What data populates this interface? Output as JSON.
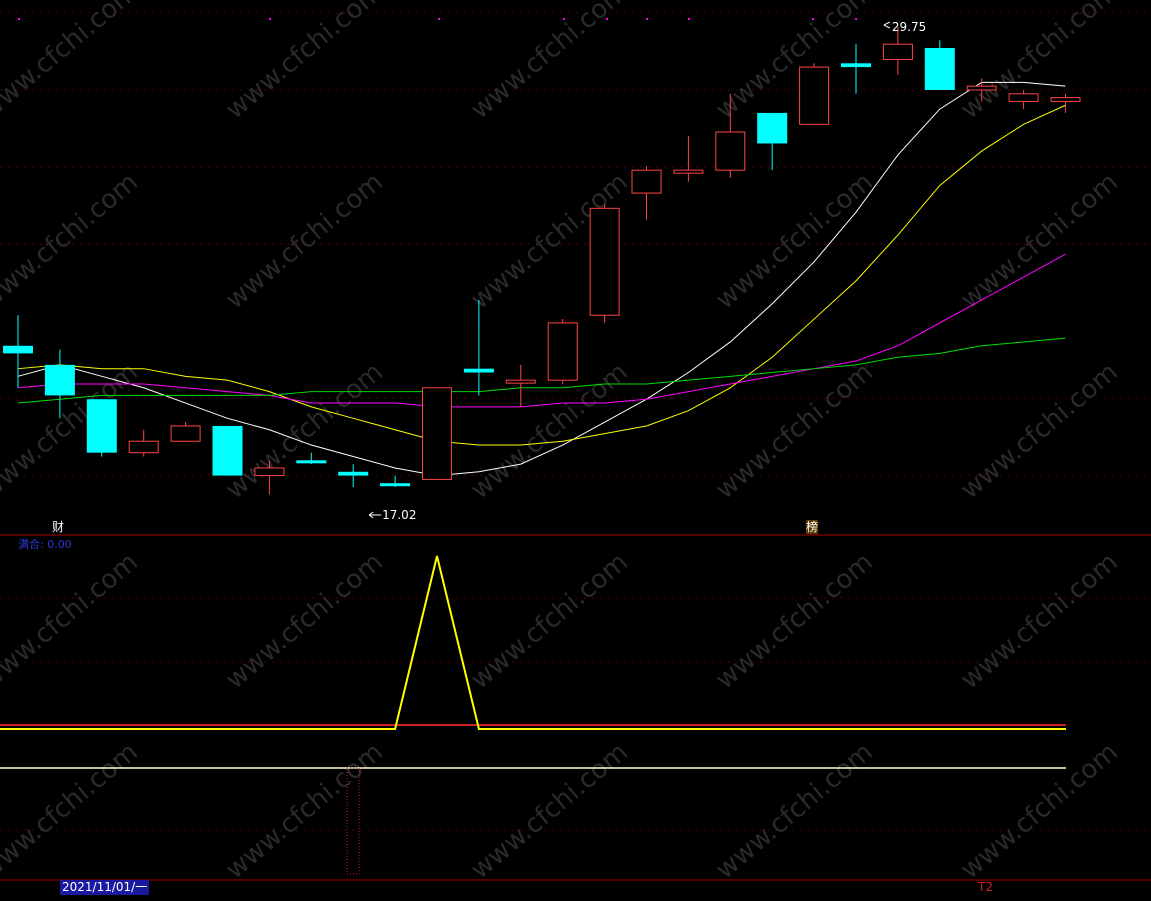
{
  "chart_data": {
    "type": "candlestick",
    "price_labels": {
      "high": "29.75",
      "low": "17.02"
    },
    "candles": [
      {
        "o": 21.4,
        "h": 22.2,
        "l": 20.3,
        "c": 21.2,
        "dir": "down"
      },
      {
        "o": 20.9,
        "h": 21.3,
        "l": 19.5,
        "c": 20.1,
        "dir": "down"
      },
      {
        "o": 20.0,
        "h": 20.0,
        "l": 18.5,
        "c": 18.6,
        "dir": "down"
      },
      {
        "o": 18.6,
        "h": 19.2,
        "l": 18.5,
        "c": 18.9,
        "dir": "up"
      },
      {
        "o": 18.9,
        "h": 19.4,
        "l": 18.9,
        "c": 19.3,
        "dir": "up"
      },
      {
        "o": 19.3,
        "h": 19.3,
        "l": 18.0,
        "c": 18.0,
        "dir": "down"
      },
      {
        "o": 18.0,
        "h": 18.4,
        "l": 17.5,
        "c": 18.2,
        "dir": "up"
      },
      {
        "o": 18.4,
        "h": 18.6,
        "l": 18.3,
        "c": 18.4,
        "dir": "down"
      },
      {
        "o": 18.1,
        "h": 18.3,
        "l": 17.7,
        "c": 18.0,
        "dir": "down"
      },
      {
        "o": 17.8,
        "h": 18.0,
        "l": 17.7,
        "c": 17.8,
        "dir": "down"
      },
      {
        "o": 17.9,
        "h": 20.3,
        "l": 17.9,
        "c": 20.3,
        "dir": "up"
      },
      {
        "o": 20.8,
        "h": 22.6,
        "l": 20.1,
        "c": 20.7,
        "dir": "down"
      },
      {
        "o": 20.5,
        "h": 20.9,
        "l": 19.8,
        "c": 20.5,
        "dir": "up"
      },
      {
        "o": 20.5,
        "h": 22.1,
        "l": 20.4,
        "c": 22.0,
        "dir": "up"
      },
      {
        "o": 22.2,
        "h": 25.1,
        "l": 22.0,
        "c": 25.0,
        "dir": "up"
      },
      {
        "o": 25.4,
        "h": 26.1,
        "l": 24.7,
        "c": 26.0,
        "dir": "up"
      },
      {
        "o": 26.0,
        "h": 26.9,
        "l": 25.7,
        "c": 26.0,
        "dir": "up"
      },
      {
        "o": 26.0,
        "h": 28.0,
        "l": 25.8,
        "c": 27.0,
        "dir": "up"
      },
      {
        "o": 27.5,
        "h": 27.5,
        "l": 26.0,
        "c": 26.7,
        "dir": "down"
      },
      {
        "o": 27.2,
        "h": 28.8,
        "l": 27.2,
        "c": 28.7,
        "dir": "up"
      },
      {
        "o": 28.8,
        "h": 29.3,
        "l": 28.0,
        "c": 28.7,
        "dir": "down"
      },
      {
        "o": 28.9,
        "h": 29.75,
        "l": 28.5,
        "c": 29.3,
        "dir": "up"
      },
      {
        "o": 29.2,
        "h": 29.4,
        "l": 28.1,
        "c": 28.1,
        "dir": "down"
      },
      {
        "o": 28.1,
        "h": 28.4,
        "l": 27.8,
        "c": 28.2,
        "dir": "up"
      },
      {
        "o": 27.8,
        "h": 28.1,
        "l": 27.6,
        "c": 28.0,
        "dir": "up"
      },
      {
        "o": 27.8,
        "h": 28.0,
        "l": 27.5,
        "c": 27.9,
        "dir": "up"
      }
    ],
    "ma_lines": [
      {
        "color": "#ffffff",
        "values": [
          20.6,
          20.9,
          20.6,
          20.3,
          19.9,
          19.5,
          19.2,
          18.8,
          18.5,
          18.2,
          18.0,
          18.1,
          18.3,
          18.8,
          19.4,
          20.0,
          20.7,
          21.5,
          22.5,
          23.6,
          24.9,
          26.4,
          27.6,
          28.3,
          28.3,
          28.2
        ]
      },
      {
        "color": "#ffff00",
        "values": [
          20.8,
          20.9,
          20.8,
          20.8,
          20.6,
          20.5,
          20.2,
          19.8,
          19.5,
          19.2,
          18.9,
          18.8,
          18.8,
          18.9,
          19.1,
          19.3,
          19.7,
          20.3,
          21.1,
          22.1,
          23.1,
          24.3,
          25.6,
          26.5,
          27.2,
          27.7
        ]
      },
      {
        "color": "#ff00ff",
        "values": [
          20.3,
          20.4,
          20.4,
          20.4,
          20.3,
          20.2,
          20.1,
          19.9,
          19.9,
          19.9,
          19.8,
          19.8,
          19.8,
          19.9,
          19.9,
          20.0,
          20.2,
          20.4,
          20.6,
          20.8,
          21.0,
          21.4,
          22.0,
          22.6,
          23.2,
          23.8
        ]
      },
      {
        "color": "#00dd00",
        "values": [
          19.9,
          20.0,
          20.1,
          20.1,
          20.1,
          20.1,
          20.1,
          20.2,
          20.2,
          20.2,
          20.2,
          20.2,
          20.3,
          20.3,
          20.4,
          20.4,
          20.5,
          20.6,
          20.7,
          20.8,
          20.9,
          21.1,
          21.2,
          21.4,
          21.5,
          21.6
        ]
      }
    ],
    "indicator": {
      "label": "满合: 0.00",
      "values": [
        0,
        0,
        0,
        0,
        0,
        0,
        0,
        0,
        0,
        0,
        1,
        0,
        0,
        0,
        0,
        0,
        0,
        0,
        0,
        0,
        0,
        0,
        0,
        0,
        0,
        0
      ],
      "colors": {
        "line": "#ffff00",
        "baseline": "#cc2222"
      }
    },
    "markers": {
      "cai": "财",
      "bang": "榜"
    },
    "bottom_bar": {
      "date": "2021/11/01/一",
      "right": "T2"
    },
    "colors": {
      "up": "#ff4444",
      "down": "#00ffff",
      "background": "#000000",
      "grid": "#8b0000"
    },
    "watermark": "www.cfchi.com"
  }
}
